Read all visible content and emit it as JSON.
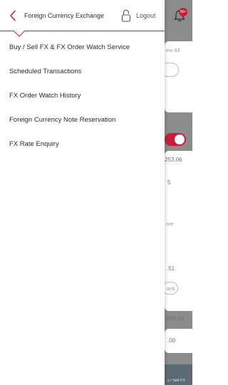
{
  "header": {
    "title": "Foreign Currency Exchange",
    "logout_label": "Logout"
  },
  "menu": {
    "items": [
      {
        "label": "Buy / Sell FX & FX Order Watch Service"
      },
      {
        "label": "Scheduled Transactions"
      },
      {
        "label": "FX Order Watch History"
      },
      {
        "label": "Foreign Currency Note Reservation"
      },
      {
        "label": "FX Rate Enquiry"
      }
    ]
  },
  "background": {
    "notification_badge": "99+",
    "view_all": "ew All",
    "amount_1": "253.06",
    "amount_2": "5",
    "more_label": "ore",
    "amount_3": ".51",
    "card_pill": "ard",
    "amount_4": ".000.00",
    "amount_5": ".00",
    "bottom_tab_label": "y / Sell FX"
  },
  "colors": {
    "accent": "#c91d3d",
    "text": "#2b2b2b",
    "overlay": "rgba(0,0,0,0.45)"
  }
}
